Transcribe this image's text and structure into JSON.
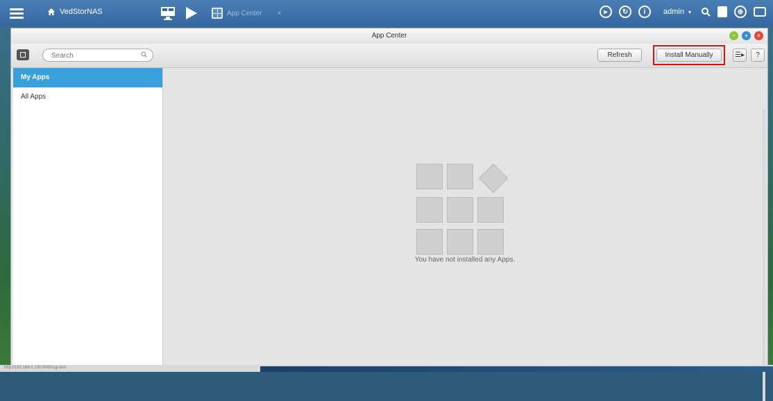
{
  "taskbar": {
    "home_label": "VedStorNAS",
    "app_tab_label": "App Center",
    "app_tab_close": "×",
    "user_label": "admin",
    "user_caret": "▾",
    "icons": [
      "menu-icon",
      "home-icon",
      "monitor-icon",
      "play-icon",
      "app-center-icon",
      "clock-icon",
      "sync-icon",
      "info-icon",
      "search-icon",
      "notification-icon",
      "globe-icon",
      "chat-icon"
    ]
  },
  "window": {
    "title": "App Center",
    "controls": {
      "min": "–",
      "max": "+",
      "close": "×"
    }
  },
  "toolbar": {
    "search_placeholder": "Search",
    "refresh_label": "Refresh",
    "install_label": "Install Manually",
    "sort_label": "☰▸",
    "help_label": "?"
  },
  "sidebar": {
    "items": [
      {
        "label": "My Apps",
        "active": true
      },
      {
        "label": "All Apps",
        "active": false
      }
    ]
  },
  "main": {
    "empty_message": "You have not installed any Apps."
  },
  "status_bar": {
    "text": "http://192.168.0.100:8080/cgi-bin/"
  },
  "colors": {
    "taskbar": "#3a6ca6",
    "active_item": "#3aa0dc",
    "highlight": "#e01010",
    "window_bg": "#e4e4e4"
  }
}
